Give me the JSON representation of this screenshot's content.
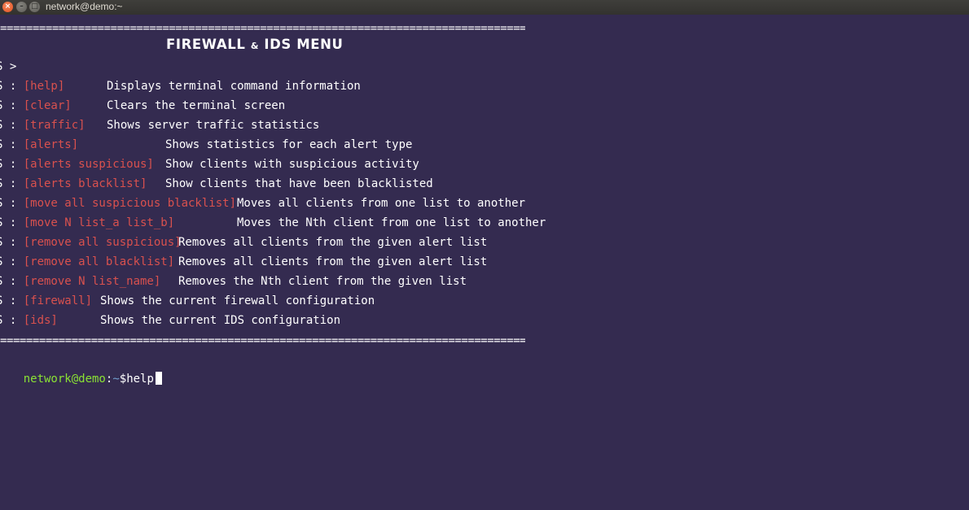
{
  "window": {
    "title": "network@demo:~",
    "close_glyph": "×",
    "min_glyph": "–",
    "max_glyph": "□"
  },
  "rule_text": "=====================================================================================",
  "menu": {
    "title_left": "FIREWALL",
    "title_amp": "&",
    "title_right": "IDS MENU"
  },
  "prompt_line": "S >",
  "entries": [
    {
      "prefix": "S : ",
      "cmd": "[help]",
      "desc": "Displays terminal command information"
    },
    {
      "prefix": "S : ",
      "cmd": "[clear]",
      "desc": "Clears the terminal screen"
    },
    {
      "prefix": "S : ",
      "cmd": "[traffic]",
      "desc": "Shows server traffic statistics"
    },
    {
      "prefix": "S : ",
      "cmd": "[alerts]",
      "desc": "Shows statistics for each alert type"
    },
    {
      "prefix": "S : ",
      "cmd": "[alerts suspicious]",
      "desc": "Show clients with suspicious activity"
    },
    {
      "prefix": "S : ",
      "cmd": "[alerts blacklist]",
      "desc": "Show clients that have been blacklisted"
    },
    {
      "prefix": "S : ",
      "cmd": "[move all suspicious blacklist]",
      "desc": "Moves all clients from one list to another"
    },
    {
      "prefix": "S : ",
      "cmd": "[move N list_a list_b]",
      "desc": "Moves the Nth client from one list to another"
    },
    {
      "prefix": "S : ",
      "cmd": "[remove all suspicious]",
      "desc": "Removes all clients from the given alert list"
    },
    {
      "prefix": "S : ",
      "cmd": "[remove all blacklist]",
      "desc": "Removes all clients from the given alert list"
    },
    {
      "prefix": "S : ",
      "cmd": "[remove N list_name]",
      "desc": "Removes the Nth client from the given list"
    },
    {
      "prefix": "S : ",
      "cmd": "[firewall]",
      "desc": "Shows the current firewall configuration"
    },
    {
      "prefix": "S : ",
      "cmd": "[ids]",
      "desc": "Shows the current IDS configuration"
    }
  ],
  "shell": {
    "user_host": "network@demo",
    "sep": ":",
    "path": "~",
    "dollar": "$",
    "input": "help"
  },
  "colors": {
    "background": "#342b50",
    "command": "#d9514e",
    "user_host": "#8ae234",
    "path": "#729fcf"
  }
}
